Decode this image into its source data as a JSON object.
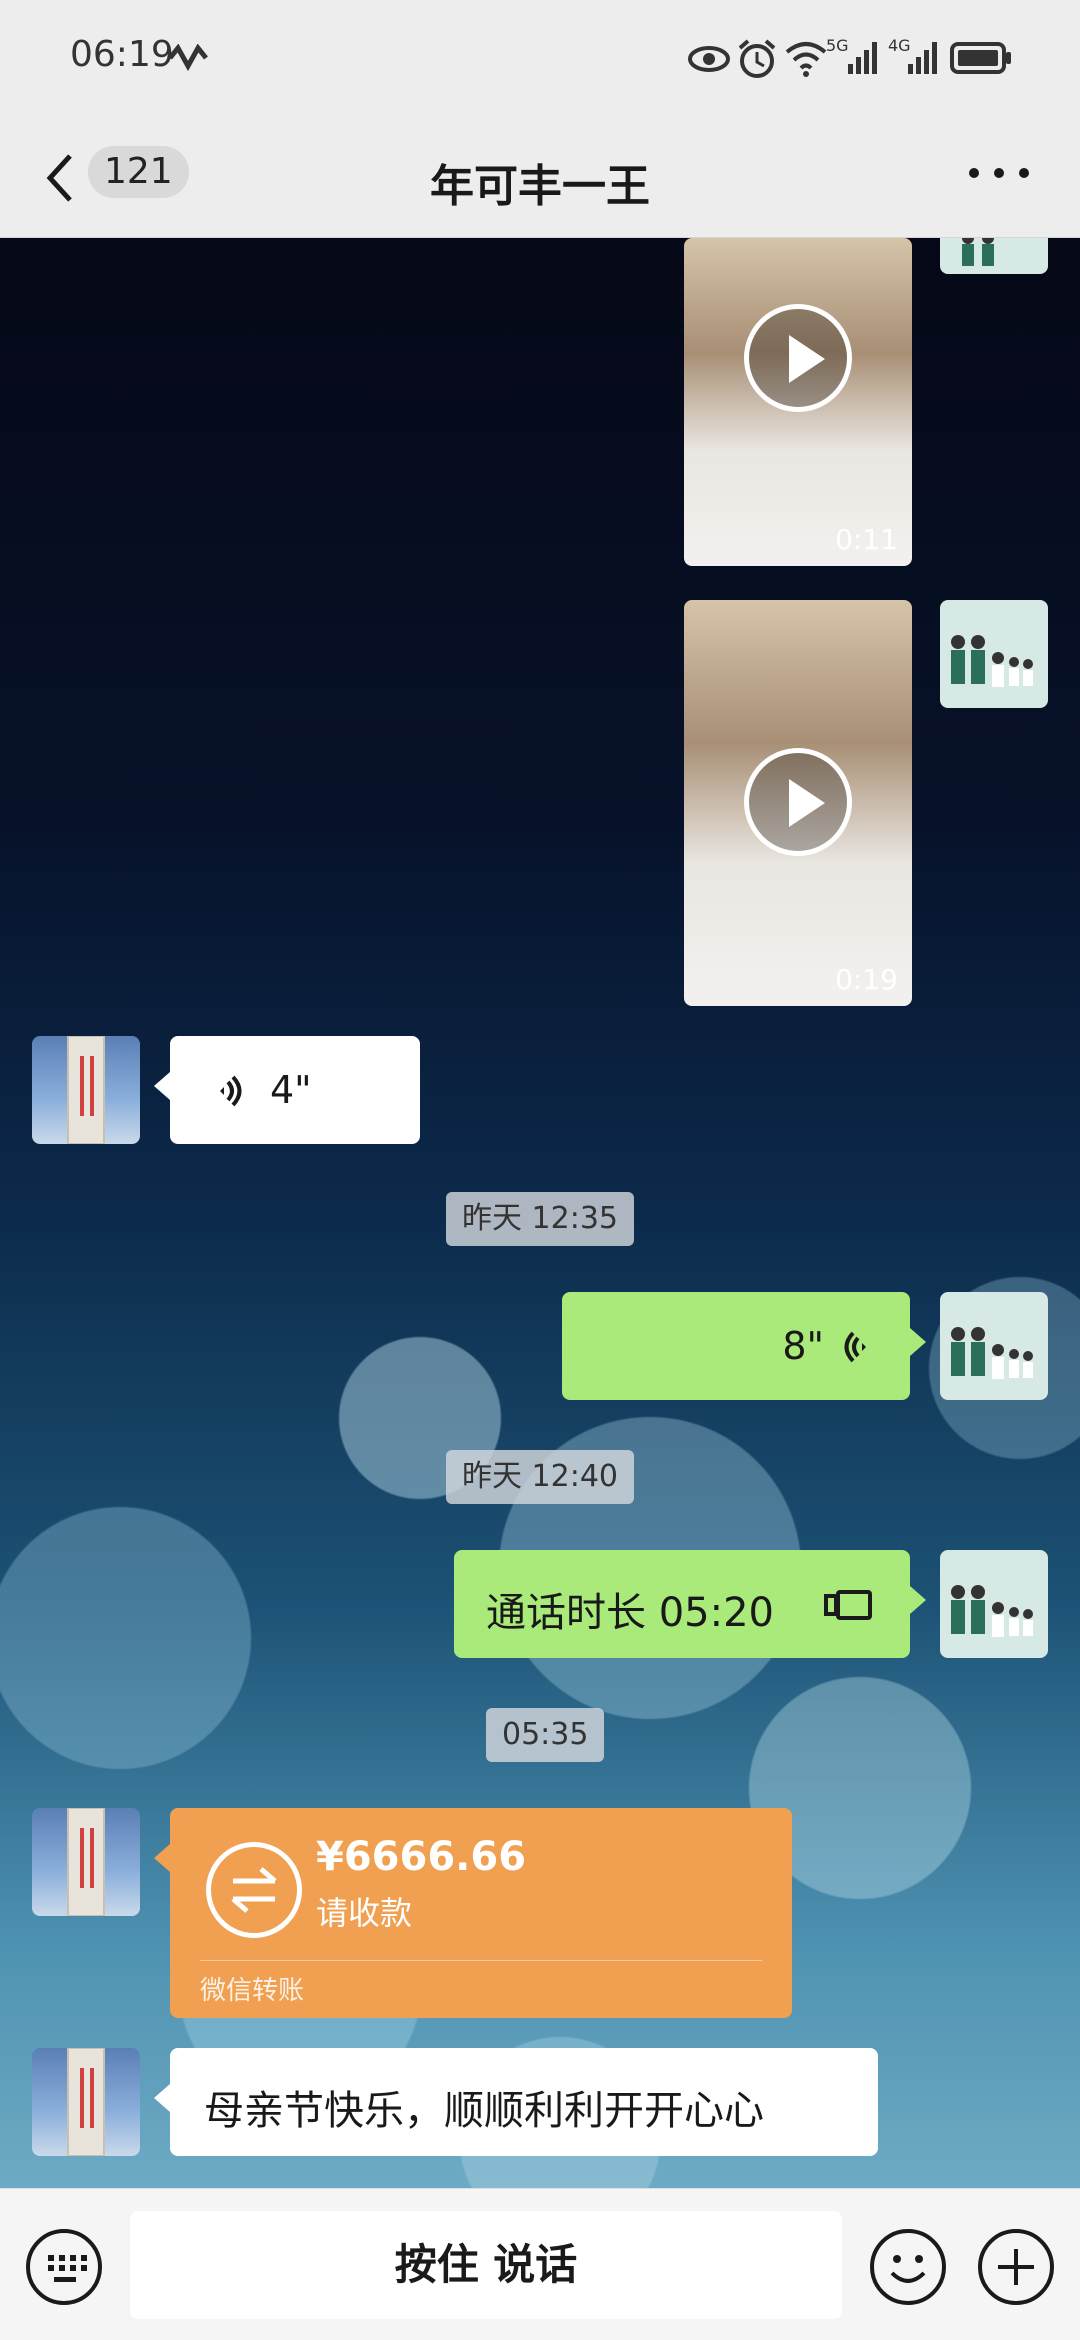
{
  "status_bar": {
    "time": "06:19",
    "icons": [
      "heart-rate-icon",
      "eye-icon",
      "alarm-icon",
      "wifi-icon",
      "signal-5g-icon",
      "signal-4g-icon",
      "battery-icon"
    ],
    "network_5g": "5G",
    "network_4g": "4G"
  },
  "header": {
    "back_icon": "chevron-left-icon",
    "unread_count": "121",
    "title": "年可丰一王",
    "more_icon": "more-horizontal-icon"
  },
  "messages": [
    {
      "type": "video",
      "side": "right",
      "duration": "0:11"
    },
    {
      "type": "video",
      "side": "right",
      "duration": "0:19"
    },
    {
      "type": "voice",
      "side": "left",
      "duration": "4\""
    },
    {
      "type": "time",
      "text": "昨天 12:35"
    },
    {
      "type": "voice",
      "side": "right",
      "duration": "8\""
    },
    {
      "type": "time",
      "text": "昨天 12:40"
    },
    {
      "type": "call",
      "side": "right",
      "text": "通话时长 05:20"
    },
    {
      "type": "time",
      "text": "05:35"
    },
    {
      "type": "transfer",
      "side": "left",
      "amount": "¥6666.66",
      "status": "请收款",
      "label": "微信转账"
    },
    {
      "type": "text",
      "side": "left",
      "text": "母亲节快乐，顺顺利利开开心心"
    }
  ],
  "input_bar": {
    "hold_to_talk": "按住 说话",
    "keyboard_icon": "keyboard-icon",
    "emoji_icon": "emoji-icon",
    "plus_icon": "plus-icon"
  },
  "colors": {
    "header_bg": "#ededed",
    "my_bubble": "#a9ea7a",
    "other_bubble": "#ffffff",
    "transfer_card": "#f0a050"
  }
}
